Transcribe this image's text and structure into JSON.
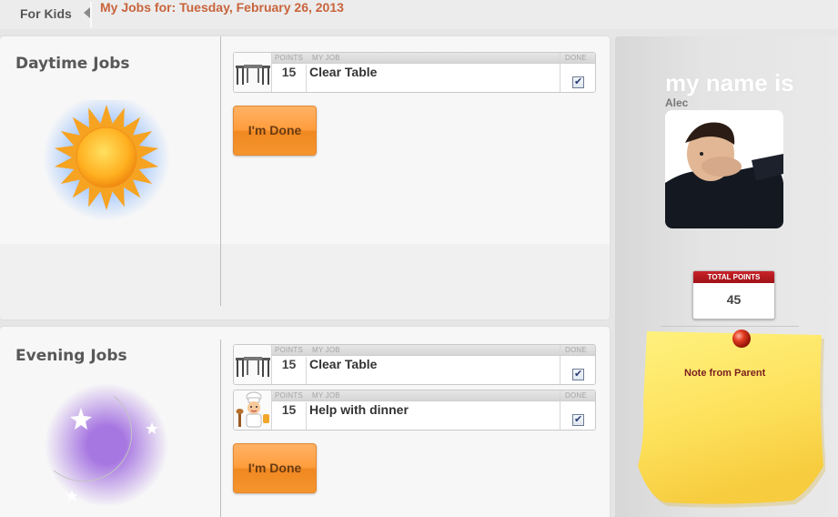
{
  "topbar": {
    "for_kids": "For Kids",
    "title": "My Jobs for: Tuesday, February 26, 2013"
  },
  "daytime": {
    "title": "Daytime Jobs",
    "icon": "sun-icon",
    "jobs": [
      {
        "icon": "table-chairs-icon",
        "points_label": "POINTS",
        "job_label": "MY JOB",
        "done_label": "DONE",
        "points": "15",
        "name": "Clear Table",
        "done": true
      }
    ],
    "done_button": "I'm Done"
  },
  "evening": {
    "title": "Evening Jobs",
    "icon": "moon-stars-icon",
    "jobs": [
      {
        "icon": "table-chairs-icon",
        "points_label": "POINTS",
        "job_label": "MY JOB",
        "done_label": "DONE",
        "points": "15",
        "name": "Clear Table",
        "done": true
      },
      {
        "icon": "chef-icon",
        "points_label": "POINTS",
        "job_label": "MY JOB",
        "done_label": "DONE",
        "points": "15",
        "name": "Help with dinner",
        "done": true
      }
    ],
    "done_button": "I'm Done"
  },
  "sidebar": {
    "my_name_is": "my name is",
    "kid_name": "Alec",
    "total_points_label": "TOTAL POINTS",
    "total_points": "45",
    "note_label": "Note from Parent"
  },
  "colors": {
    "title_orange": "#c8643c",
    "button_orange": "#ff9d3c",
    "total_points_red": "#b0181f",
    "note_yellow": "#fde36a"
  }
}
